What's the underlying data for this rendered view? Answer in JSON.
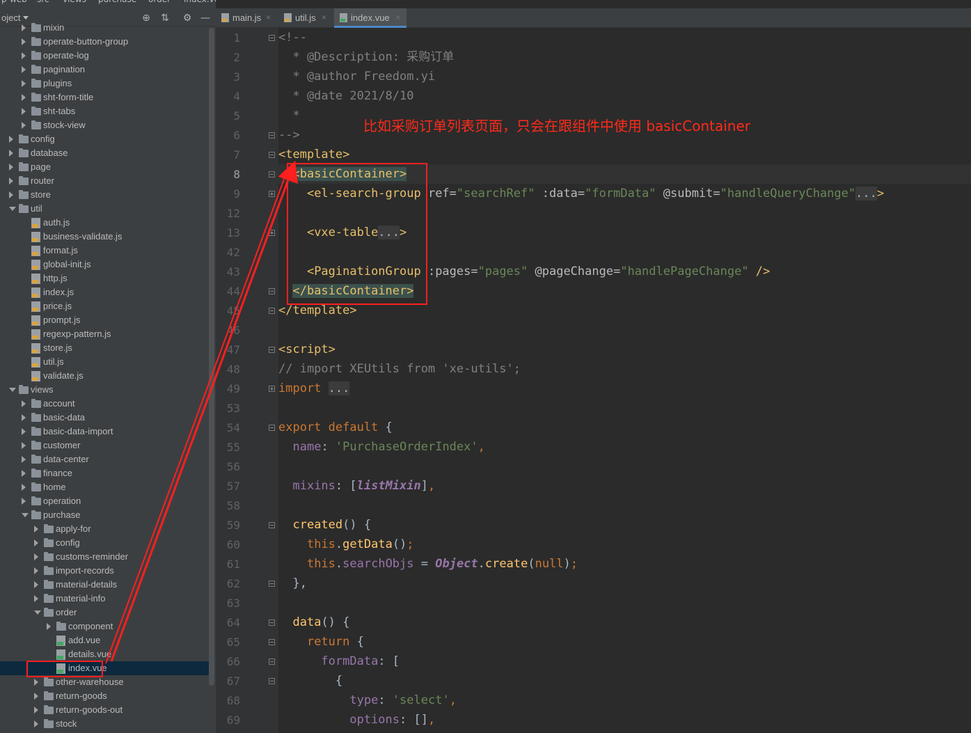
{
  "breadcrumb": [
    "p-web",
    "src",
    "views",
    "purchase",
    "order",
    "index.vue"
  ],
  "project_panel": {
    "title": "oject",
    "buttons": [
      "locate-icon",
      "collapse-icon",
      "gear-icon",
      "minimize-icon"
    ]
  },
  "tree": [
    {
      "label": "mixin",
      "type": "folder",
      "depth": 2,
      "state": "closed",
      "partial": true
    },
    {
      "label": "operate-button-group",
      "type": "folder",
      "depth": 2,
      "state": "closed"
    },
    {
      "label": "operate-log",
      "type": "folder",
      "depth": 2,
      "state": "closed"
    },
    {
      "label": "pagination",
      "type": "folder",
      "depth": 2,
      "state": "closed"
    },
    {
      "label": "plugins",
      "type": "folder",
      "depth": 2,
      "state": "closed"
    },
    {
      "label": "sht-form-title",
      "type": "folder",
      "depth": 2,
      "state": "closed"
    },
    {
      "label": "sht-tabs",
      "type": "folder",
      "depth": 2,
      "state": "closed"
    },
    {
      "label": "stock-view",
      "type": "folder",
      "depth": 2,
      "state": "closed"
    },
    {
      "label": "config",
      "type": "folder",
      "depth": 1,
      "state": "closed"
    },
    {
      "label": "database",
      "type": "folder",
      "depth": 1,
      "state": "closed"
    },
    {
      "label": "page",
      "type": "folder",
      "depth": 1,
      "state": "closed"
    },
    {
      "label": "router",
      "type": "folder",
      "depth": 1,
      "state": "closed"
    },
    {
      "label": "store",
      "type": "folder",
      "depth": 1,
      "state": "closed"
    },
    {
      "label": "util",
      "type": "folder",
      "depth": 1,
      "state": "open"
    },
    {
      "label": "auth.js",
      "type": "js",
      "depth": 2
    },
    {
      "label": "business-validate.js",
      "type": "js",
      "depth": 2
    },
    {
      "label": "format.js",
      "type": "js",
      "depth": 2
    },
    {
      "label": "global-init.js",
      "type": "js",
      "depth": 2
    },
    {
      "label": "http.js",
      "type": "js",
      "depth": 2
    },
    {
      "label": "index.js",
      "type": "js",
      "depth": 2
    },
    {
      "label": "price.js",
      "type": "js",
      "depth": 2
    },
    {
      "label": "prompt.js",
      "type": "js",
      "depth": 2
    },
    {
      "label": "regexp-pattern.js",
      "type": "js",
      "depth": 2
    },
    {
      "label": "store.js",
      "type": "js",
      "depth": 2
    },
    {
      "label": "util.js",
      "type": "js",
      "depth": 2
    },
    {
      "label": "validate.js",
      "type": "js",
      "depth": 2
    },
    {
      "label": "views",
      "type": "folder",
      "depth": 1,
      "state": "open"
    },
    {
      "label": "account",
      "type": "folder",
      "depth": 2,
      "state": "closed"
    },
    {
      "label": "basic-data",
      "type": "folder",
      "depth": 2,
      "state": "closed"
    },
    {
      "label": "basic-data-import",
      "type": "folder",
      "depth": 2,
      "state": "closed"
    },
    {
      "label": "customer",
      "type": "folder",
      "depth": 2,
      "state": "closed"
    },
    {
      "label": "data-center",
      "type": "folder",
      "depth": 2,
      "state": "closed"
    },
    {
      "label": "finance",
      "type": "folder",
      "depth": 2,
      "state": "closed"
    },
    {
      "label": "home",
      "type": "folder",
      "depth": 2,
      "state": "closed"
    },
    {
      "label": "operation",
      "type": "folder",
      "depth": 2,
      "state": "closed"
    },
    {
      "label": "purchase",
      "type": "folder",
      "depth": 2,
      "state": "open"
    },
    {
      "label": "apply-for",
      "type": "folder",
      "depth": 3,
      "state": "closed"
    },
    {
      "label": "config",
      "type": "folder",
      "depth": 3,
      "state": "closed"
    },
    {
      "label": "customs-reminder",
      "type": "folder",
      "depth": 3,
      "state": "closed"
    },
    {
      "label": "import-records",
      "type": "folder",
      "depth": 3,
      "state": "closed"
    },
    {
      "label": "material-details",
      "type": "folder",
      "depth": 3,
      "state": "closed"
    },
    {
      "label": "material-info",
      "type": "folder",
      "depth": 3,
      "state": "closed"
    },
    {
      "label": "order",
      "type": "folder",
      "depth": 3,
      "state": "open"
    },
    {
      "label": "component",
      "type": "folder",
      "depth": 4,
      "state": "closed"
    },
    {
      "label": "add.vue",
      "type": "vue",
      "depth": 4
    },
    {
      "label": "details.vue",
      "type": "vue",
      "depth": 4
    },
    {
      "label": "index.vue",
      "type": "vue",
      "depth": 4,
      "selected": true
    },
    {
      "label": "other-warehouse",
      "type": "folder",
      "depth": 3,
      "state": "closed"
    },
    {
      "label": "return-goods",
      "type": "folder",
      "depth": 3,
      "state": "closed"
    },
    {
      "label": "return-goods-out",
      "type": "folder",
      "depth": 3,
      "state": "closed"
    },
    {
      "label": "stock",
      "type": "folder",
      "depth": 3,
      "state": "closed"
    }
  ],
  "tabs": [
    {
      "label": "main.js",
      "type": "js",
      "active": false
    },
    {
      "label": "util.js",
      "type": "js",
      "active": false
    },
    {
      "label": "index.vue",
      "type": "vue",
      "active": true
    }
  ],
  "code": [
    {
      "ln": "1",
      "fold": "minus",
      "parts": [
        [
          "c-comment",
          "<!--"
        ]
      ]
    },
    {
      "ln": "2",
      "parts": [
        [
          "c-comment",
          "  * @Description: 采购订单"
        ]
      ]
    },
    {
      "ln": "3",
      "parts": [
        [
          "c-comment",
          "  * @author Freedom.yi"
        ]
      ]
    },
    {
      "ln": "4",
      "parts": [
        [
          "c-comment",
          "  * @date 2021/8/10"
        ]
      ]
    },
    {
      "ln": "5",
      "parts": [
        [
          "c-comment",
          "  *"
        ]
      ]
    },
    {
      "ln": "6",
      "fold": "minus",
      "parts": [
        [
          "c-comment",
          "-->"
        ]
      ]
    },
    {
      "ln": "7",
      "fold": "minus",
      "parts": [
        [
          "c-tag",
          "<template>"
        ]
      ]
    },
    {
      "ln": "8",
      "fold": "minus",
      "current": true,
      "parts": [
        [
          "",
          "  "
        ],
        [
          "c-tag c-match",
          "<basicContainer>"
        ]
      ]
    },
    {
      "ln": "9",
      "fold": "plus",
      "parts": [
        [
          "",
          "    "
        ],
        [
          "c-tag",
          "<el-search-group "
        ],
        [
          "c-attr",
          "ref="
        ],
        [
          "c-str",
          "\"searchRef\" "
        ],
        [
          "c-attr",
          ":data="
        ],
        [
          "c-str",
          "\"formData\" "
        ],
        [
          "c-attr",
          "@submit="
        ],
        [
          "c-str",
          "\"handleQueryChange\""
        ],
        [
          "c-fold",
          "..."
        ],
        [
          "c-tag",
          ">"
        ]
      ]
    },
    {
      "ln": "12",
      "parts": [
        [
          "",
          ""
        ]
      ]
    },
    {
      "ln": "13",
      "fold": "plus",
      "parts": [
        [
          "",
          "    "
        ],
        [
          "c-tag",
          "<vxe-table"
        ],
        [
          "c-fold",
          "..."
        ],
        [
          "c-tag",
          ">"
        ]
      ]
    },
    {
      "ln": "42",
      "parts": [
        [
          "",
          ""
        ]
      ]
    },
    {
      "ln": "43",
      "parts": [
        [
          "",
          "    "
        ],
        [
          "c-tag",
          "<PaginationGroup "
        ],
        [
          "c-attr",
          ":pages="
        ],
        [
          "c-str",
          "\"pages\" "
        ],
        [
          "c-attr",
          "@pageChange="
        ],
        [
          "c-str",
          "\"handlePageChange\" "
        ],
        [
          "c-tag",
          "/>"
        ]
      ]
    },
    {
      "ln": "44",
      "fold": "minus",
      "parts": [
        [
          "",
          "  "
        ],
        [
          "c-tag c-match",
          "</basicContainer>"
        ]
      ]
    },
    {
      "ln": "45",
      "fold": "minus",
      "parts": [
        [
          "c-tag",
          "</template>"
        ]
      ]
    },
    {
      "ln": "46",
      "parts": [
        [
          "",
          ""
        ]
      ]
    },
    {
      "ln": "47",
      "fold": "minus",
      "parts": [
        [
          "c-tag",
          "<script>"
        ]
      ]
    },
    {
      "ln": "48",
      "parts": [
        [
          "c-comment",
          "// import XEUtils from 'xe-utils';"
        ]
      ]
    },
    {
      "ln": "49",
      "fold": "plus",
      "parts": [
        [
          "c-kw",
          "import "
        ],
        [
          "c-fold",
          "..."
        ]
      ]
    },
    {
      "ln": "53",
      "parts": [
        [
          "",
          ""
        ]
      ]
    },
    {
      "ln": "54",
      "fold": "minus",
      "parts": [
        [
          "c-kw",
          "export default "
        ],
        [
          "",
          "{"
        ]
      ]
    },
    {
      "ln": "55",
      "parts": [
        [
          "",
          "  "
        ],
        [
          "c-prop",
          "name"
        ],
        [
          "",
          ": "
        ],
        [
          "c-str",
          "'PurchaseOrderIndex'"
        ],
        [
          "c-kw",
          ","
        ]
      ]
    },
    {
      "ln": "56",
      "parts": [
        [
          "",
          ""
        ]
      ]
    },
    {
      "ln": "57",
      "parts": [
        [
          "",
          "  "
        ],
        [
          "c-prop",
          "mixins"
        ],
        [
          "",
          ": ["
        ],
        [
          "c-ital",
          "listMixin"
        ],
        [
          "",
          "]"
        ],
        [
          "c-kw",
          ","
        ]
      ]
    },
    {
      "ln": "58",
      "parts": [
        [
          "",
          ""
        ]
      ]
    },
    {
      "ln": "59",
      "fold": "minus",
      "parts": [
        [
          "",
          "  "
        ],
        [
          "c-fn",
          "created"
        ],
        [
          "",
          "() {"
        ]
      ]
    },
    {
      "ln": "60",
      "parts": [
        [
          "",
          "    "
        ],
        [
          "c-kw",
          "this"
        ],
        [
          "",
          "."
        ],
        [
          "c-fn",
          "getData"
        ],
        [
          "",
          "()"
        ],
        [
          "c-kw",
          ";"
        ]
      ]
    },
    {
      "ln": "61",
      "parts": [
        [
          "",
          "    "
        ],
        [
          "c-kw",
          "this"
        ],
        [
          "",
          "."
        ],
        [
          "c-prop",
          "searchObjs"
        ],
        [
          "",
          " = "
        ],
        [
          "c-ital",
          "Object"
        ],
        [
          "",
          "."
        ],
        [
          "c-fn",
          "create"
        ],
        [
          "",
          "("
        ],
        [
          "c-kw",
          "null"
        ],
        [
          "",
          ")"
        ],
        [
          "c-kw",
          ";"
        ]
      ]
    },
    {
      "ln": "62",
      "fold": "minus",
      "parts": [
        [
          "",
          "  },"
        ]
      ]
    },
    {
      "ln": "63",
      "parts": [
        [
          "",
          ""
        ]
      ]
    },
    {
      "ln": "64",
      "fold": "minus",
      "parts": [
        [
          "",
          "  "
        ],
        [
          "c-fn",
          "data"
        ],
        [
          "",
          "() {"
        ]
      ]
    },
    {
      "ln": "65",
      "fold": "minus",
      "parts": [
        [
          "",
          "    "
        ],
        [
          "c-kw",
          "return "
        ],
        [
          "",
          "{"
        ]
      ]
    },
    {
      "ln": "66",
      "fold": "minus",
      "parts": [
        [
          "",
          "      "
        ],
        [
          "c-prop",
          "formData"
        ],
        [
          "",
          ": ["
        ]
      ]
    },
    {
      "ln": "67",
      "fold": "minus",
      "parts": [
        [
          "",
          "        {"
        ]
      ]
    },
    {
      "ln": "68",
      "parts": [
        [
          "",
          "          "
        ],
        [
          "c-prop",
          "type"
        ],
        [
          "",
          ": "
        ],
        [
          "c-str",
          "'select'"
        ],
        [
          "c-kw",
          ","
        ]
      ]
    },
    {
      "ln": "69",
      "parts": [
        [
          "",
          "          "
        ],
        [
          "c-prop",
          "options"
        ],
        [
          "",
          ": []"
        ],
        [
          "c-kw",
          ","
        ]
      ]
    }
  ],
  "annotation": {
    "text": "比如采购订单列表页面，只会在跟组件中使用 basicContainer",
    "color": "#ff2a1a"
  }
}
